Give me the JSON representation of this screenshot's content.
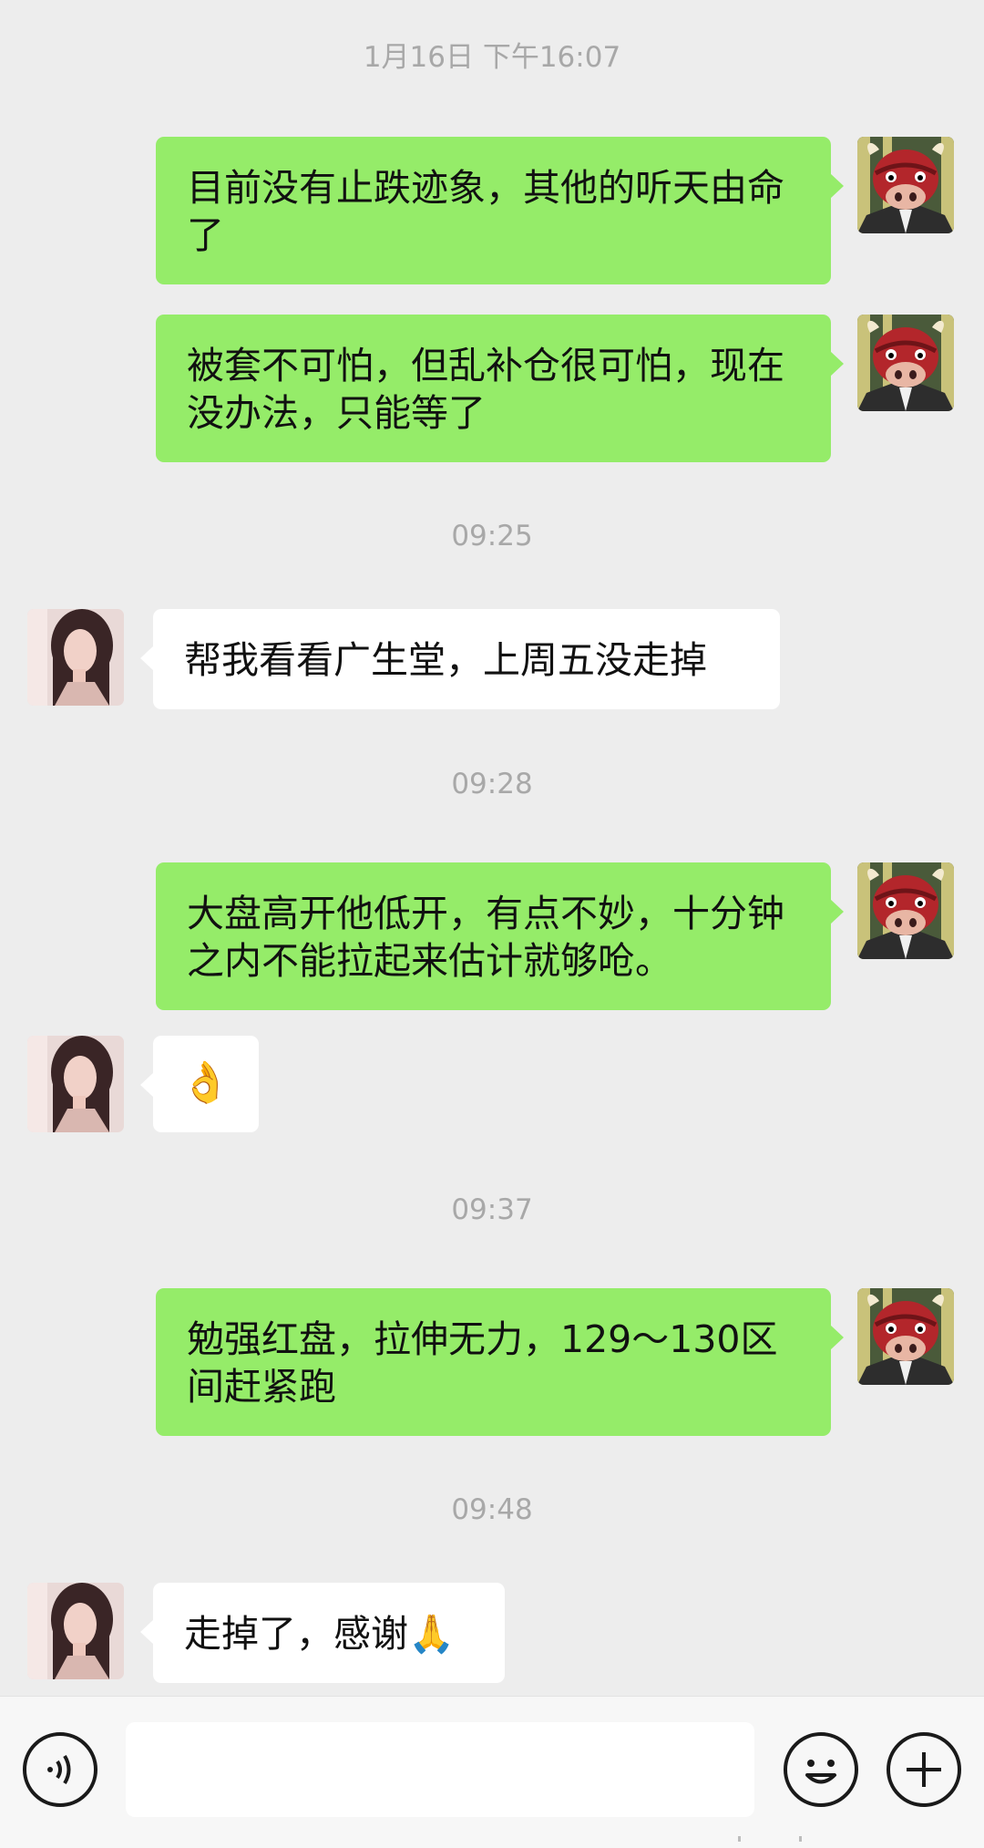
{
  "chat": {
    "messages": [
      {
        "type": "time",
        "text": "1月16日 下午16:07"
      },
      {
        "type": "bubble",
        "sender": "self",
        "text": "目前没有止跌迹象，其他的听天由命了"
      },
      {
        "type": "bubble",
        "sender": "self",
        "text": "被套不可怕，但乱补仓很可怕，现在没办法，只能等了"
      },
      {
        "type": "time",
        "text": "09:25"
      },
      {
        "type": "bubble",
        "sender": "other",
        "text": "帮我看看广生堂，上周五没走掉"
      },
      {
        "type": "time",
        "text": "09:28"
      },
      {
        "type": "bubble",
        "sender": "self",
        "text": "大盘高开他低开，有点不妙，十分钟之内不能拉起来估计就够呛。"
      },
      {
        "type": "bubble",
        "sender": "other",
        "text": "👌"
      },
      {
        "type": "time",
        "text": "09:37"
      },
      {
        "type": "bubble",
        "sender": "self",
        "text": "勉强红盘，拉伸无力，129～130区间赶紧跑"
      },
      {
        "type": "time",
        "text": "09:48"
      },
      {
        "type": "bubble",
        "sender": "other",
        "text": "走掉了，感谢🙏"
      }
    ]
  },
  "avatars": {
    "self": "bull-cartoon-avatar",
    "other": "girl-photo-avatar"
  },
  "bottom_bar": {
    "voice_icon": "voice-icon",
    "input_value": "",
    "emoji_icon": "emoji-icon",
    "plus_icon": "plus-icon"
  },
  "colors": {
    "background": "#ededed",
    "self_bubble": "#95ec69",
    "other_bubble": "#ffffff",
    "timestamp_text": "#a8a8a8"
  }
}
